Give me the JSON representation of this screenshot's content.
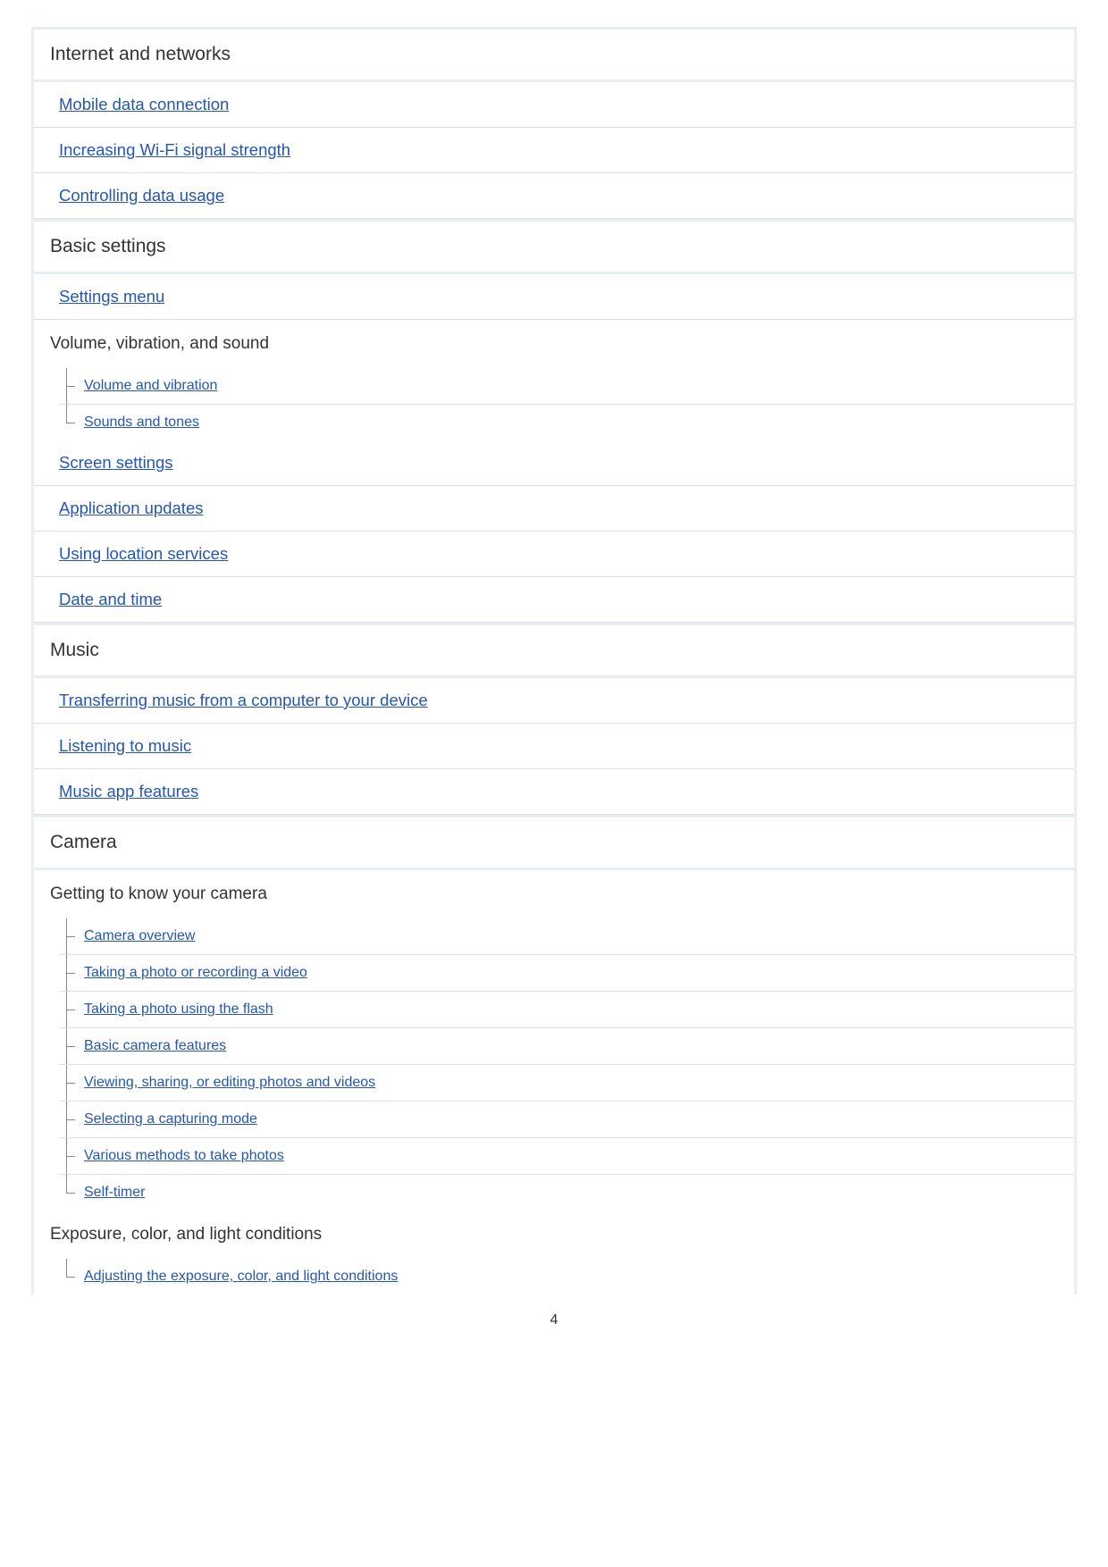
{
  "sections": [
    {
      "title": "Internet and networks",
      "items": [
        {
          "type": "link",
          "label": "Mobile data connection"
        },
        {
          "type": "link",
          "label": "Increasing Wi-Fi signal strength"
        },
        {
          "type": "link",
          "label": "Controlling data usage"
        }
      ]
    },
    {
      "title": "Basic settings",
      "items": [
        {
          "type": "link",
          "label": "Settings menu"
        },
        {
          "type": "subheader",
          "label": "Volume, vibration, and sound",
          "children": [
            {
              "label": "Volume and vibration"
            },
            {
              "label": "Sounds and tones"
            }
          ]
        },
        {
          "type": "link",
          "label": "Screen settings"
        },
        {
          "type": "link",
          "label": "Application updates"
        },
        {
          "type": "link",
          "label": "Using location services"
        },
        {
          "type": "link",
          "label": "Date and time"
        }
      ]
    },
    {
      "title": "Music",
      "items": [
        {
          "type": "link",
          "label": "Transferring music from a computer to your device"
        },
        {
          "type": "link",
          "label": "Listening to music"
        },
        {
          "type": "link",
          "label": "Music app features"
        }
      ]
    },
    {
      "title": "Camera",
      "items": [
        {
          "type": "subheader",
          "label": "Getting to know your camera",
          "children": [
            {
              "label": "Camera overview"
            },
            {
              "label": "Taking a photo or recording a video"
            },
            {
              "label": "Taking a photo using the flash"
            },
            {
              "label": "Basic camera features"
            },
            {
              "label": "Viewing, sharing, or editing photos and videos"
            },
            {
              "label": "Selecting a capturing mode"
            },
            {
              "label": "Various methods to take photos"
            },
            {
              "label": "Self-timer"
            }
          ]
        },
        {
          "type": "subheader",
          "label": "Exposure, color, and light conditions",
          "children": [
            {
              "label": "Adjusting the exposure, color, and light conditions"
            }
          ]
        }
      ]
    }
  ],
  "page_number": "4"
}
